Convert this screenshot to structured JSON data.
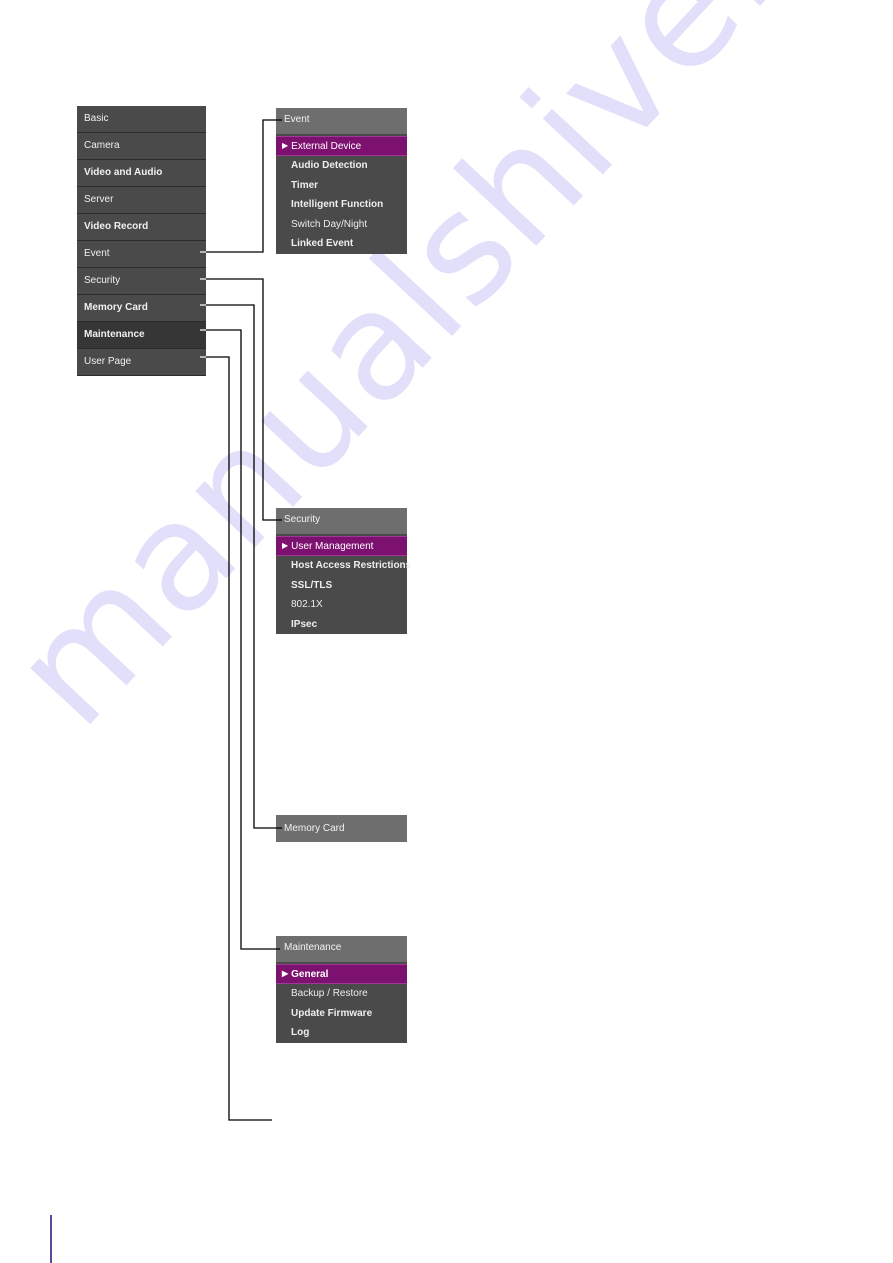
{
  "main_menu": {
    "items": [
      {
        "label": "Basic",
        "bold": false
      },
      {
        "label": "Camera",
        "bold": false
      },
      {
        "label": "Video and Audio",
        "bold": true
      },
      {
        "label": "Server",
        "bold": false
      },
      {
        "label": "Video Record",
        "bold": true
      },
      {
        "label": "Event",
        "bold": false
      },
      {
        "label": "Security",
        "bold": false
      },
      {
        "label": "Memory Card",
        "bold": true
      },
      {
        "label": "Maintenance",
        "bold": true,
        "active": true
      },
      {
        "label": "User Page",
        "bold": false
      }
    ]
  },
  "submenus": {
    "event": {
      "title": "Event",
      "items": [
        "External Device",
        "Audio Detection",
        "Timer",
        "Intelligent Function",
        "Switch Day/Night",
        "Linked Event"
      ],
      "selected": "External Device"
    },
    "security": {
      "title": "Security",
      "items": [
        "User Management",
        "Host Access Restrictions",
        "SSL/TLS",
        "802.1X",
        "IPsec"
      ],
      "selected": "User Management"
    },
    "memory_card": {
      "title": "Memory Card",
      "items": []
    },
    "maintenance": {
      "title": "Maintenance",
      "items": [
        "General",
        "Backup / Restore",
        "Update Firmware",
        "Log"
      ],
      "selected": "General"
    }
  },
  "icons": {
    "selected_marker": "▶"
  },
  "colors": {
    "menu_bg": "#4a4a4a",
    "header_bg": "#6e6e6e",
    "selected_bg": "#7d1170",
    "watermark": "#c9c6f5"
  },
  "watermark": "manualshive.com"
}
